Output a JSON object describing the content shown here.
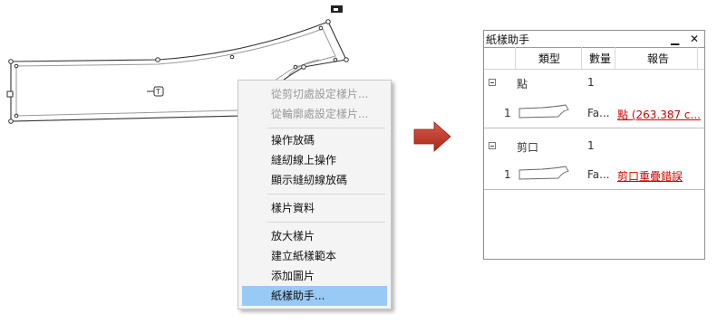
{
  "context_menu": {
    "items": [
      {
        "label": "從剪切處設定樣片...",
        "enabled": false
      },
      {
        "label": "從輪廓處設定樣片...",
        "enabled": false
      },
      {
        "label": "操作放碼",
        "enabled": true
      },
      {
        "label": "縫紉線上操作",
        "enabled": true
      },
      {
        "label": "顯示縫紉線放碼",
        "enabled": true
      },
      {
        "label": "樣片資料",
        "enabled": true
      },
      {
        "label": "放大樣片",
        "enabled": true
      },
      {
        "label": "建立紙樣範本",
        "enabled": true
      },
      {
        "label": "添加圖片",
        "enabled": true
      },
      {
        "label": "紙樣助手...",
        "enabled": true,
        "selected": true
      }
    ]
  },
  "panel": {
    "title": "紙樣助手",
    "pin_glyph": "▁",
    "close_glyph": "✕",
    "columns": [
      "類型",
      "數量",
      "報告"
    ],
    "groups": [
      {
        "expander": "minus",
        "type": "點",
        "count": "1",
        "row": {
          "index": "1",
          "name": "Fa...",
          "report": "點 (263.387 c..."
        }
      },
      {
        "expander": "minus",
        "type": "剪口",
        "count": "1",
        "row": {
          "index": "1",
          "name": "Fa...",
          "report": "剪口重疊錯誤"
        }
      }
    ]
  },
  "colors": {
    "menu_highlight": "#99c9f5",
    "error_red": "#d40000",
    "arrow_red": "#c0392b"
  },
  "icons": [
    "marker-box-icon",
    "pattern-cursor-icon",
    "right-arrow-icon",
    "expander-minus-icon",
    "pattern-thumbnail-icon"
  ]
}
